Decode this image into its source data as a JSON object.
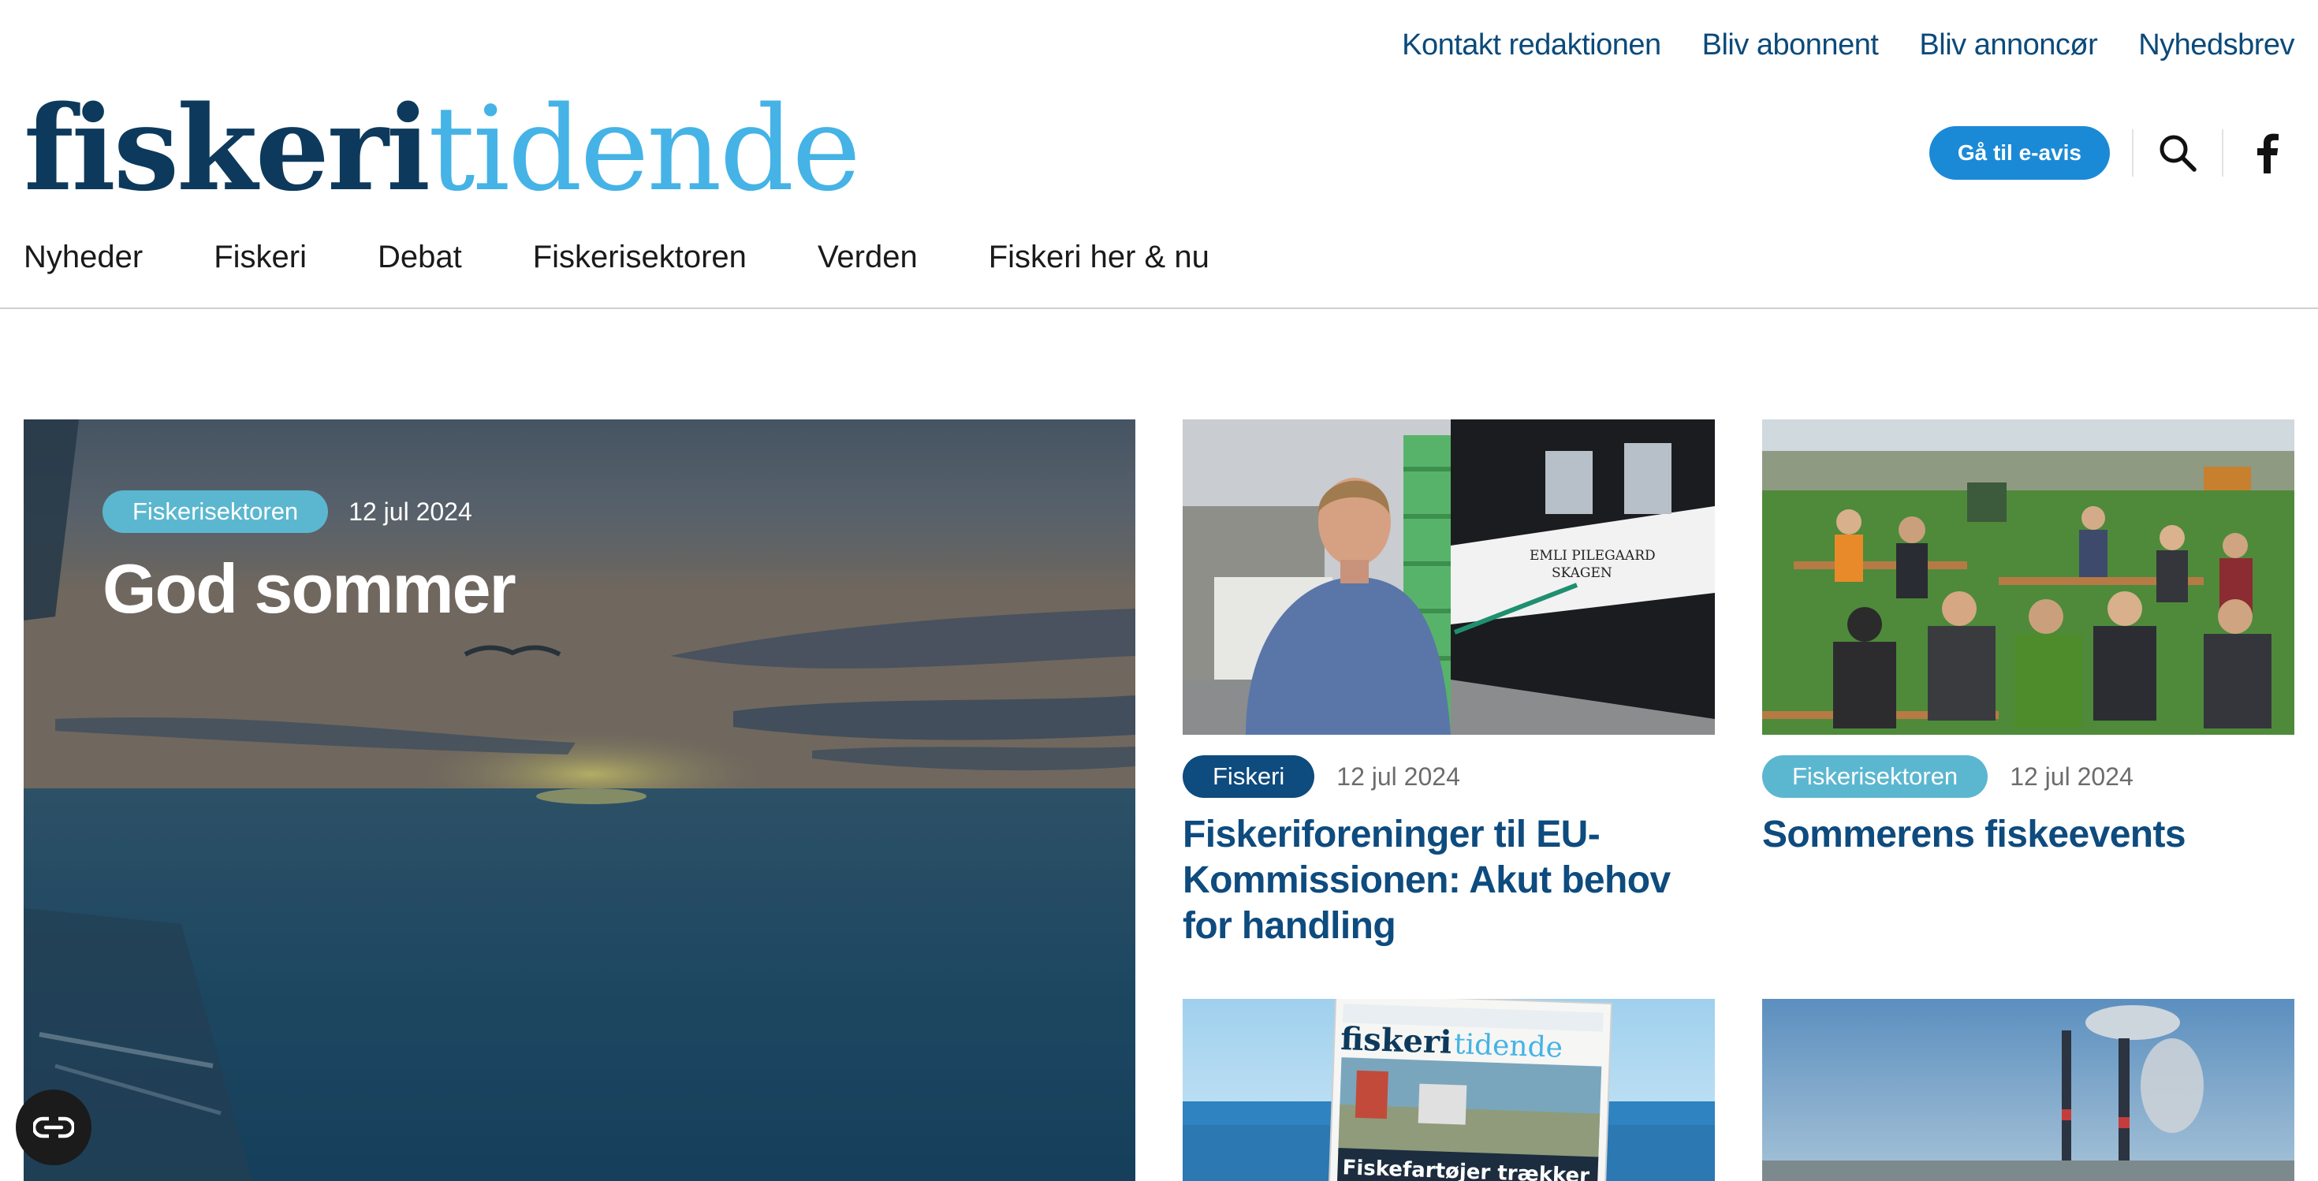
{
  "utility_nav": {
    "items": [
      "Kontakt redaktionen",
      "Bliv abonnent",
      "Bliv annoncør",
      "Nyhedsbrev"
    ]
  },
  "logo": {
    "part1": "fiskeri",
    "part2": "tidende"
  },
  "header": {
    "eavis_label": "Gå til e-avis",
    "search_icon": "search-icon",
    "facebook_icon": "facebook-icon"
  },
  "main_nav": {
    "items": [
      "Nyheder",
      "Fiskeri",
      "Debat",
      "Fiskerisektoren",
      "Verden",
      "Fiskeri her & nu"
    ]
  },
  "hero": {
    "category": "Fiskerisektoren",
    "date": "12 jul 2024",
    "title": "God sommer"
  },
  "cards": [
    {
      "category": "Fiskeri",
      "date": "12 jul 2024",
      "title": "Fiskeriforeninger til EU-Kommissionen: Akut behov for handling",
      "boat_name_line1": "EMLI PILEGAARD",
      "boat_name_line2": "SKAGEN"
    },
    {
      "category": "Fiskerisektoren",
      "date": "12 jul 2024",
      "title": "Sommerens fiskeevents"
    },
    {
      "magazine_masthead_part1": "fiskeri",
      "magazine_masthead_part2": "tidende",
      "magazine_headline": "Fiskefartøjer trækker"
    },
    {}
  ],
  "colors": {
    "brand_dark": "#0d3a5c",
    "brand_light": "#45b3e6",
    "link": "#0b4a7a",
    "title_blue": "#0e4b7e",
    "pill_light": "#5bb7cf",
    "pill_dark": "#0e4b7e",
    "button": "#1b8ad6"
  },
  "chat_icon": "chat-icon"
}
